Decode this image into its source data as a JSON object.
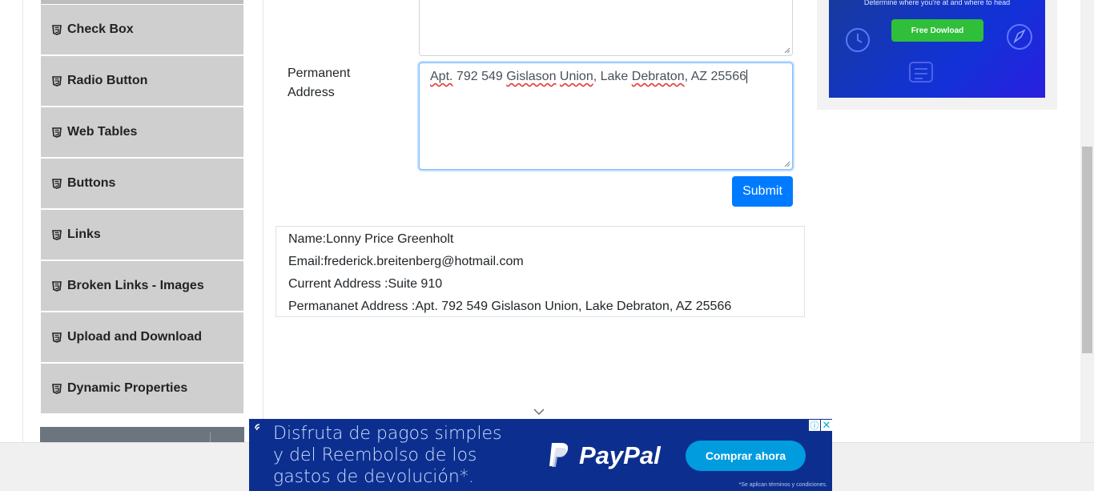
{
  "sidebar": {
    "items": [
      {
        "label": "Check Box",
        "icon": "html5-icon"
      },
      {
        "label": "Radio Button",
        "icon": "html5-icon"
      },
      {
        "label": "Web Tables",
        "icon": "html5-icon"
      },
      {
        "label": "Buttons",
        "icon": "html5-icon"
      },
      {
        "label": "Links",
        "icon": "html5-icon"
      },
      {
        "label": "Broken Links - Images",
        "icon": "html5-icon"
      },
      {
        "label": "Upload and Download",
        "icon": "html5-icon"
      },
      {
        "label": "Dynamic Properties",
        "icon": "html5-icon"
      }
    ]
  },
  "form": {
    "permanent_address_label_line1": "Permanent",
    "permanent_address_label_line2": "Address",
    "permanent_address_value": {
      "w1": "Apt.",
      "w2": "792 549",
      "w3": "Gislason",
      "w4": "Union",
      "w5": ", Lake",
      "w6": "Debraton",
      "w7": ", AZ 25566"
    },
    "submit_label": "Submit"
  },
  "output": {
    "name": "Name:Lonny Price Greenholt",
    "email": "Email:frederick.breitenberg@hotmail.com",
    "current_address": "Current Address :Suite 910",
    "permanent_address": "Permananet Address :Apt. 792 549 Gislason Union, Lake Debraton, AZ 25566"
  },
  "right_ad": {
    "tagline": "Determine where you're at and where to head",
    "button_label": "Free Dowload"
  },
  "bottom_ad": {
    "headline": "Disfruta de pagos simples y del Reembolso de los gastos de devolución*.",
    "brand": "PayPal",
    "cta_label": "Comprar ahora",
    "fine_print": "*Se aplican términos y condiciones.",
    "info_glyph": "ⓘ",
    "close_glyph": "✕"
  },
  "colors": {
    "primary": "#007bff",
    "sidebar_item_bg": "#cfcfcf",
    "paypal_bg": "#0c2f8f",
    "paypal_cta": "#009cde"
  }
}
